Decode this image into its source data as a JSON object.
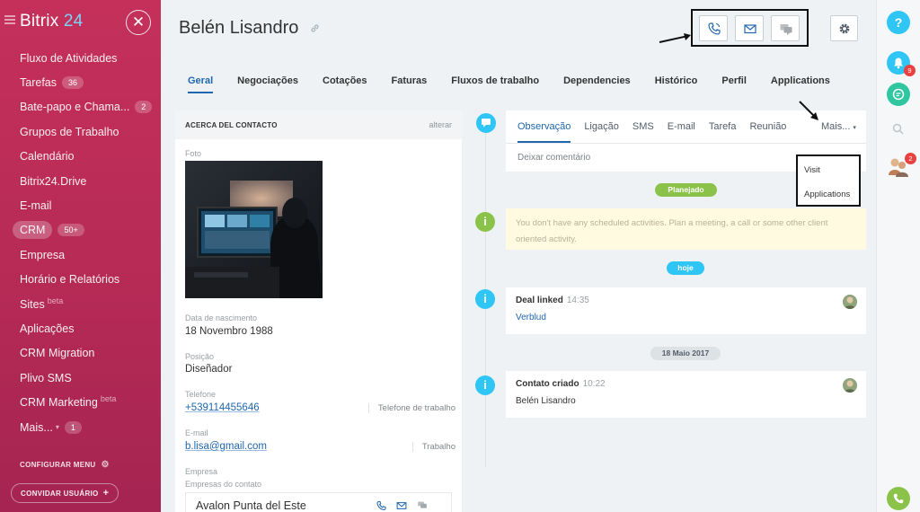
{
  "sidebar": {
    "logo_part1": "Bitrix",
    "logo_part2": "24",
    "items": [
      {
        "label": "Fluxo de Atividades"
      },
      {
        "label": "Tarefas",
        "counter": "36"
      },
      {
        "label": "Bate-papo e Chama...",
        "counter": "2"
      },
      {
        "label": "Grupos de Trabalho"
      },
      {
        "label": "Calendário"
      },
      {
        "label": "Bitrix24.Drive"
      },
      {
        "label": "E-mail"
      },
      {
        "label": "CRM",
        "counter": "50+"
      },
      {
        "label": "Empresa"
      },
      {
        "label": "Horário e Relatórios"
      },
      {
        "label": "Sites",
        "sup": "beta"
      },
      {
        "label": "Aplicações"
      },
      {
        "label": "CRM Migration"
      },
      {
        "label": "Plivo SMS"
      },
      {
        "label": "CRM Marketing",
        "sup": "beta"
      },
      {
        "label": "Mais...",
        "counter": "1"
      }
    ],
    "configure_menu": "CONFIGURAR MENU",
    "invite_users": "CONVIDAR USUÁRIO"
  },
  "header": {
    "title": "Belén Lisandro"
  },
  "tabs": [
    "Geral",
    "Negociações",
    "Cotações",
    "Faturas",
    "Fluxos de trabalho",
    "Dependencies",
    "Histórico",
    "Perfil",
    "Applications"
  ],
  "contact": {
    "heading": "ACERCA DEL CONTACTO",
    "edit": "alterar",
    "photo_label": "Foto",
    "birth_label": "Data de nascimento",
    "birth_value": "18 Novembro 1988",
    "position_label": "Posição",
    "position_value": "Diseñador",
    "phone_label": "Telefone",
    "phone_value": "+539114455646",
    "phone_type": "Telefone de trabalho",
    "email_label": "E-mail",
    "email_value": "b.lisa@gmail.com",
    "email_type": "Trabalho",
    "company_label": "Empresa",
    "company_sub": "Empresas do contato",
    "company_name": "Avalon Punta del Este"
  },
  "composer": {
    "tabs": [
      "Observação",
      "Ligação",
      "SMS",
      "E-mail",
      "Tarefa",
      "Reunião"
    ],
    "more": "Mais...",
    "placeholder": "Deixar comentário"
  },
  "dropdown": {
    "items": [
      "Visit",
      "Applications"
    ]
  },
  "timeline": {
    "planned_label": "Planejado",
    "planned_notice": "You don't have any scheduled activities. Plan a meeting, a call or some other client oriented activity.",
    "today_label": "hoje",
    "event1_title": "Deal linked",
    "event1_time": "14:35",
    "event1_link": "Verblud",
    "date_label": "18 Maio 2017",
    "event2_title": "Contato criado",
    "event2_time": "10:22",
    "event2_text": "Belén Lisandro"
  },
  "rightbar": {
    "help": "?",
    "notifications_badge": "9",
    "users_badge": "2"
  },
  "colors": {
    "sidebar": "#b82b57",
    "accent": "#2067b0",
    "green": "#8bc34a",
    "blue": "#2fc6f6"
  }
}
